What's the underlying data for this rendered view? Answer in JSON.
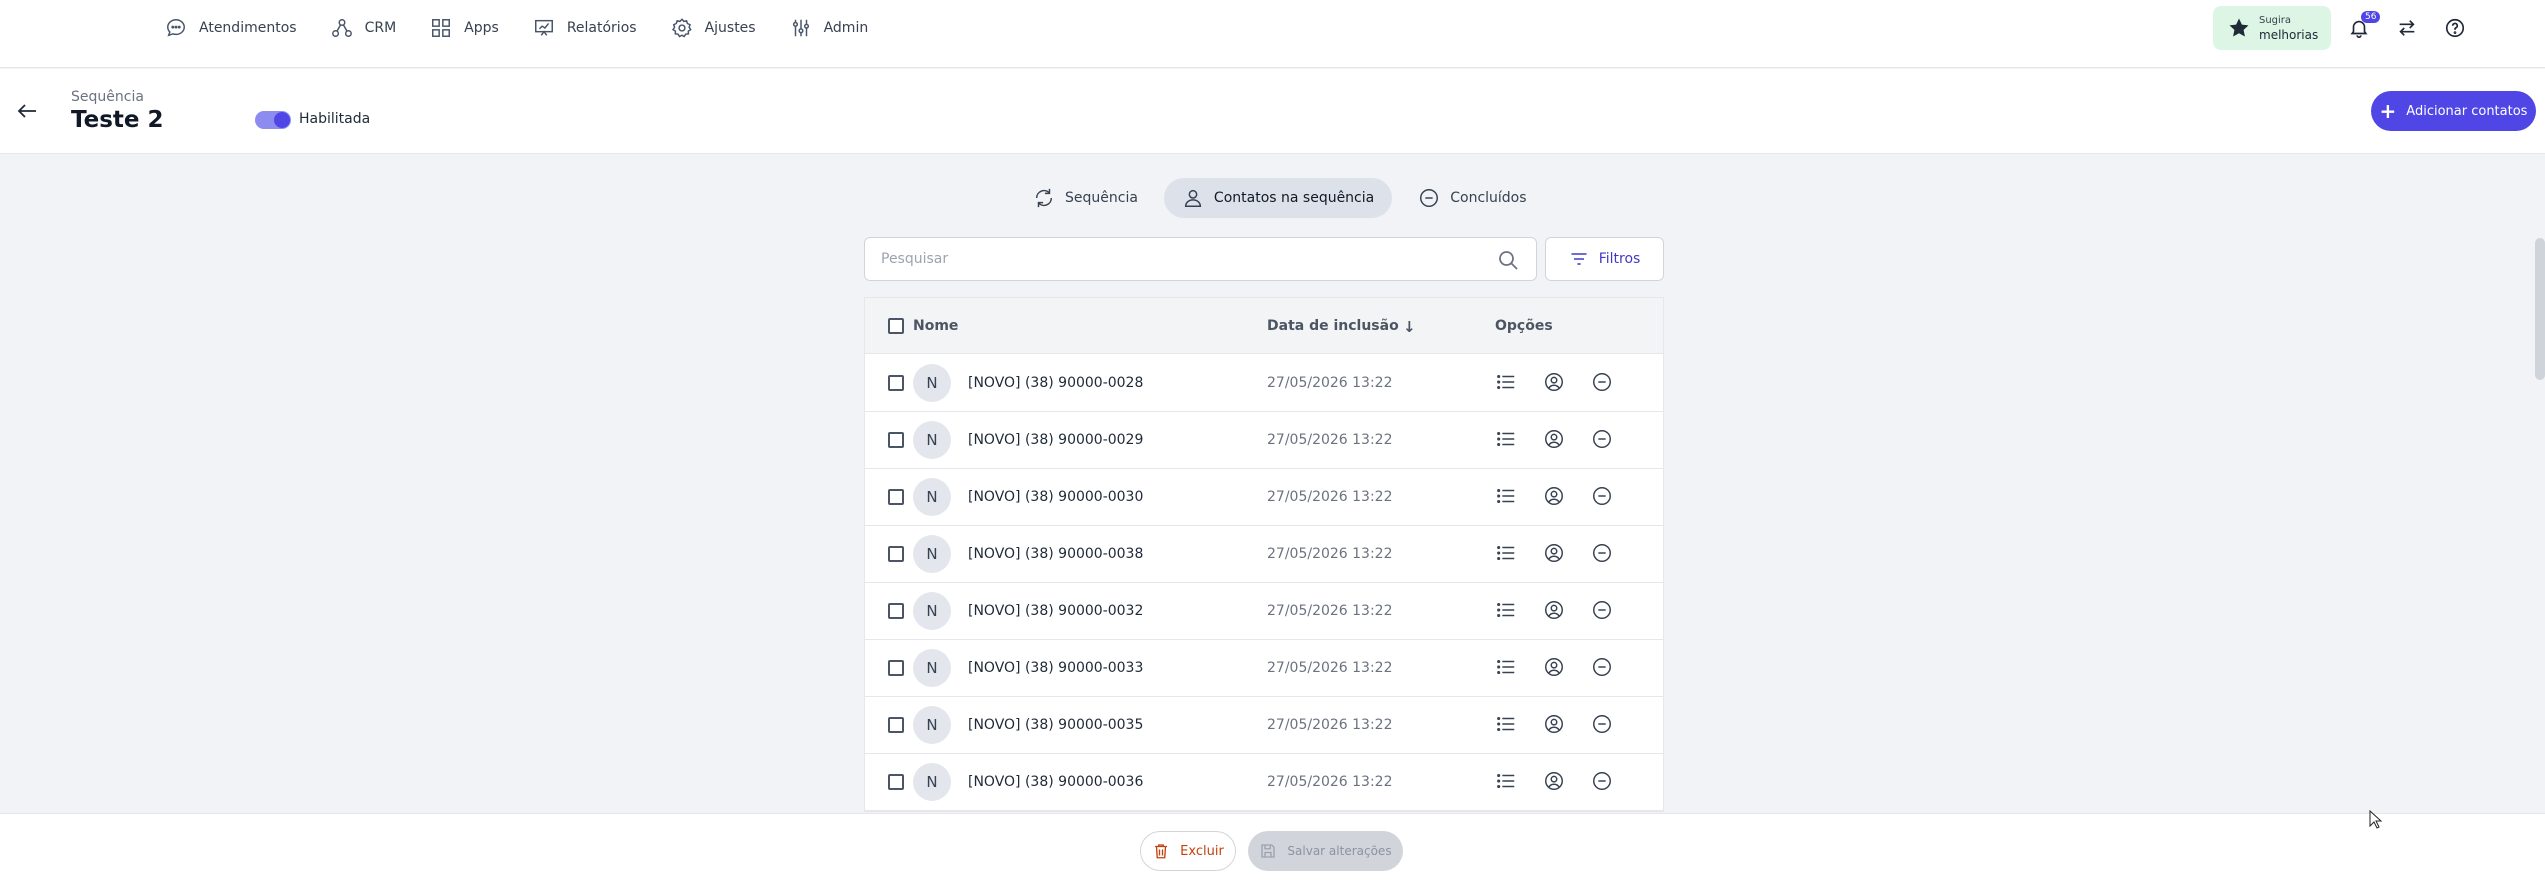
{
  "nav": {
    "items": [
      {
        "label": "Atendimentos",
        "icon": "chat-bubble-icon"
      },
      {
        "label": "CRM",
        "icon": "crm-nodes-icon"
      },
      {
        "label": "Apps",
        "icon": "apps-grid-icon"
      },
      {
        "label": "Relatórios",
        "icon": "presentation-chart-icon"
      },
      {
        "label": "Ajustes",
        "icon": "gear-icon"
      },
      {
        "label": "Admin",
        "icon": "sliders-icon"
      }
    ]
  },
  "topbar": {
    "suggest_line1": "Sugira",
    "suggest_line2": "melhorias",
    "notifications_count": "56"
  },
  "header": {
    "breadcrumb": "Sequência",
    "title": "Teste 2",
    "toggle_label": "Habilitada",
    "toggle_on": true,
    "add_button": "Adicionar contatos"
  },
  "tabs": [
    {
      "label": "Sequência",
      "active": false
    },
    {
      "label": "Contatos na sequência",
      "active": true
    },
    {
      "label": "Concluídos",
      "active": false
    }
  ],
  "search": {
    "placeholder": "Pesquisar",
    "value": ""
  },
  "filters_label": "Filtros",
  "table": {
    "columns": {
      "name": "Nome",
      "date": "Data de inclusão",
      "options": "Opções"
    },
    "rows": [
      {
        "initial": "N",
        "name": "[NOVO] (38) 90000-0028",
        "date": "27/05/2026 13:22"
      },
      {
        "initial": "N",
        "name": "[NOVO] (38) 90000-0029",
        "date": "27/05/2026 13:22"
      },
      {
        "initial": "N",
        "name": "[NOVO] (38) 90000-0030",
        "date": "27/05/2026 13:22"
      },
      {
        "initial": "N",
        "name": "[NOVO] (38) 90000-0038",
        "date": "27/05/2026 13:22"
      },
      {
        "initial": "N",
        "name": "[NOVO] (38) 90000-0032",
        "date": "27/05/2026 13:22"
      },
      {
        "initial": "N",
        "name": "[NOVO] (38) 90000-0033",
        "date": "27/05/2026 13:22"
      },
      {
        "initial": "N",
        "name": "[NOVO] (38) 90000-0035",
        "date": "27/05/2026 13:22"
      },
      {
        "initial": "N",
        "name": "[NOVO] (38) 90000-0036",
        "date": "27/05/2026 13:22"
      }
    ]
  },
  "footer": {
    "delete_label": "Excluir",
    "save_label": "Salvar alterações"
  },
  "colors": {
    "accent": "#4f46e5",
    "suggest_bg": "#dcf5e4",
    "delete": "#c2410c"
  }
}
